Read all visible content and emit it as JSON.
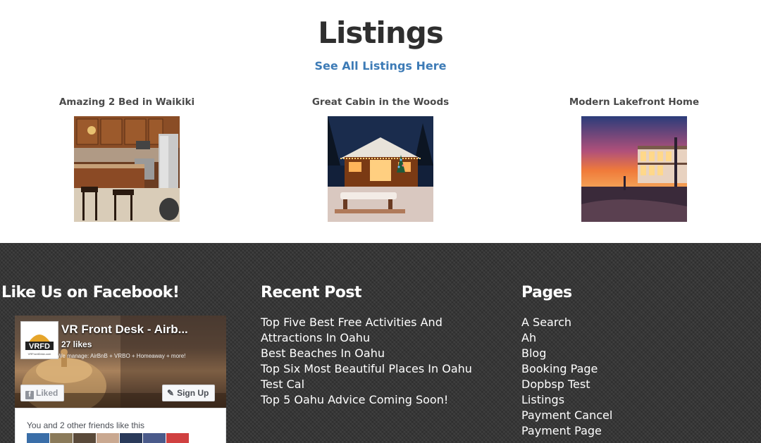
{
  "listings": {
    "title": "Listings",
    "see_all": "See All Listings Here",
    "items": [
      {
        "name": "Amazing 2 Bed in Waikiki",
        "photo": "kitchen-photo"
      },
      {
        "name": "Great Cabin in the Woods",
        "photo": "snowy-cabin-photo"
      },
      {
        "name": "Modern Lakefront Home",
        "photo": "lakefront-sunset-photo"
      }
    ]
  },
  "footer": {
    "facebook": {
      "heading": "Like Us on Facebook!",
      "page_name": "VR Front Desk - Airb...",
      "likes": "27 likes",
      "logo_text": "VRFD",
      "logo_subtext": "VRFrontDesk.com",
      "tagline": "We manage: AirBnB + VRBO + Homeaway + more!",
      "liked_label": "Liked",
      "signup_label": "Sign Up",
      "friends_text": "You and 2 other friends like this"
    },
    "recent_post": {
      "heading": "Recent Post",
      "items": [
        "Top Five Best Free Activities And Attractions In Oahu",
        "Best Beaches In Oahu",
        "Top Six Most Beautiful Places In Oahu",
        "Test Cal",
        "Top 5 Oahu Advice Coming Soon!"
      ]
    },
    "pages": {
      "heading": "Pages",
      "items": [
        "A Search",
        "Ah",
        "Blog",
        "Booking Page",
        "Dopbsp Test",
        "Listings",
        "Payment Cancel",
        "Payment Page"
      ]
    }
  },
  "colors": {
    "title": "#2f2f2f",
    "link": "#3d7bb6",
    "footer_bg": "#333333",
    "footer_text": "#ffffff"
  }
}
